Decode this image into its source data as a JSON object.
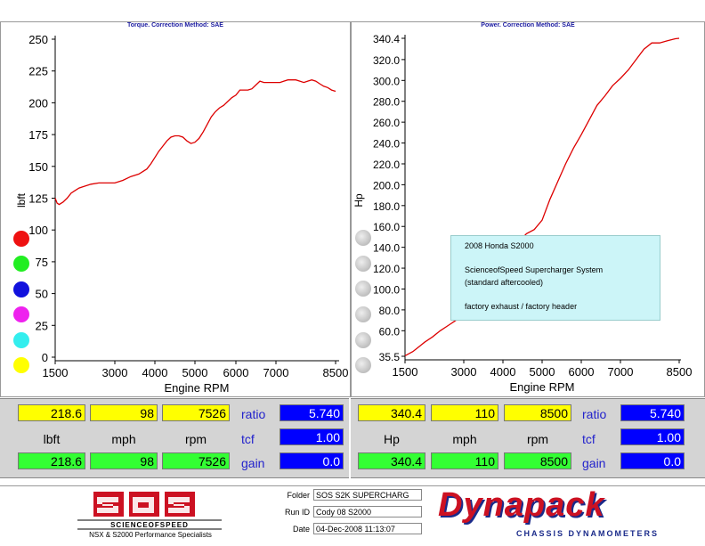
{
  "left_chart": {
    "header": "Torque.      Correction Method: SAE",
    "ylabel": "lbft",
    "xlabel": "Engine RPM",
    "yticks": [
      "250",
      "225",
      "200",
      "175",
      "150",
      "125",
      "100",
      "75",
      "50",
      "25",
      "0"
    ],
    "xticks": [
      "1500",
      "3000",
      "4000",
      "5000",
      "6000",
      "7000",
      "8500"
    ]
  },
  "right_chart": {
    "header": "Power.      Correction Method: SAE",
    "ylabel": "Hp",
    "xlabel": "Engine RPM",
    "yticks": [
      "340.4",
      "320.0",
      "300.0",
      "280.0",
      "260.0",
      "240.0",
      "220.0",
      "200.0",
      "180.0",
      "160.0",
      "140.0",
      "120.0",
      "100.0",
      "80.0",
      "60.0",
      "35.5"
    ],
    "xticks": [
      "1500",
      "3000",
      "4000",
      "5000",
      "6000",
      "7000",
      "8500"
    ]
  },
  "note": {
    "line1": "2008 Honda S2000",
    "line2": "ScienceofSpeed Supercharger System",
    "line3": "(standard aftercooled)",
    "line4": "factory exhaust / factory header"
  },
  "left_readout": {
    "top": [
      "218.6",
      "98",
      "7526"
    ],
    "units": [
      "lbft",
      "mph",
      "rpm"
    ],
    "bottom": [
      "218.6",
      "98",
      "7526"
    ],
    "ratio_label": "ratio",
    "ratio": "5.740",
    "tcf_label": "tcf",
    "tcf": "1.00",
    "gain_label": "gain",
    "gain": "0.0"
  },
  "right_readout": {
    "top": [
      "340.4",
      "110",
      "8500"
    ],
    "units": [
      "Hp",
      "mph",
      "rpm"
    ],
    "bottom": [
      "340.4",
      "110",
      "8500"
    ],
    "ratio_label": "ratio",
    "ratio": "5.740",
    "tcf_label": "tcf",
    "tcf": "1.00",
    "gain_label": "gain",
    "gain": "0.0"
  },
  "footer": {
    "logo_text": "SCIENCEOFSPEED",
    "tagline": "NSX & S2000 Performance Specialists",
    "folder_label": "Folder",
    "folder": "SOS S2K SUPERCHARG",
    "runid_label": "Run ID",
    "runid": "Cody 08 S2000",
    "date_label": "Date",
    "date": "04-Dec-2008  11:13:07",
    "brand": "Dynapack",
    "brand_sub": "CHASSIS DYNAMOMETERS"
  },
  "colors": {
    "curve": "#dd0000",
    "yellow": "#ffff00",
    "green": "#33ff33",
    "blue": "#0000ff",
    "brand_red": "#cc1122",
    "brand_blue": "#1a2a8a"
  },
  "swatches_left": [
    "#ee1111",
    "#22ee22",
    "#1111dd",
    "#ee22ee",
    "#33eeee",
    "#ffff00"
  ],
  "chart_data": [
    {
      "type": "line",
      "title": "Torque.      Correction Method: SAE",
      "xlabel": "Engine RPM",
      "ylabel": "lbft",
      "xlim": [
        1500,
        8500
      ],
      "ylim": [
        0,
        250
      ],
      "series": [
        {
          "x": [
            1500,
            1550,
            1600,
            1700,
            1800,
            1900,
            2000,
            2100,
            2200,
            2400,
            2600,
            2800,
            3000,
            3200,
            3400,
            3600,
            3800,
            3900,
            4000,
            4100,
            4200,
            4300,
            4400,
            4500,
            4600,
            4700,
            4800,
            4900,
            5000,
            5100,
            5200,
            5300,
            5400,
            5500,
            5600,
            5700,
            5800,
            5900,
            6000,
            6100,
            6200,
            6300,
            6400,
            6500,
            6600,
            6700,
            6800,
            6900,
            7000,
            7100,
            7200,
            7300,
            7400,
            7500,
            7600,
            7700,
            7800,
            7900,
            8000,
            8100,
            8200,
            8300,
            8400,
            8500
          ],
          "y": [
            125,
            121,
            120,
            122,
            125,
            129,
            131,
            133,
            134,
            136,
            137,
            137,
            137,
            139,
            142,
            144,
            148,
            152,
            157,
            162,
            166,
            170,
            173,
            174,
            174,
            173,
            170,
            168,
            169,
            172,
            177,
            183,
            189,
            193,
            196,
            198,
            201,
            204,
            206,
            210,
            210,
            210,
            211,
            214,
            217,
            216,
            216,
            216,
            216,
            216,
            217,
            218,
            218,
            218,
            217,
            216,
            217,
            218,
            217,
            215,
            213,
            212,
            210,
            209
          ]
        }
      ]
    },
    {
      "type": "line",
      "title": "Power.      Correction Method: SAE",
      "xlabel": "Engine RPM",
      "ylabel": "Hp",
      "xlim": [
        1500,
        8500
      ],
      "ylim": [
        35.5,
        340.4
      ],
      "series": [
        {
          "x": [
            1500,
            1600,
            1700,
            1800,
            1900,
            2000,
            2200,
            2400,
            2600,
            2800,
            3000,
            3200,
            3400,
            3600,
            3800,
            4000,
            4200,
            4400,
            4600,
            4800,
            5000,
            5200,
            5400,
            5600,
            5800,
            6000,
            6200,
            6400,
            6600,
            6800,
            7000,
            7200,
            7400,
            7600,
            7800,
            8000,
            8200,
            8400,
            8500
          ],
          "y": [
            36,
            38,
            40,
            43,
            46,
            49,
            54,
            60,
            65,
            70,
            75,
            80,
            86,
            92,
            100,
            112,
            130,
            145,
            153,
            157,
            166,
            186,
            203,
            220,
            235,
            248,
            262,
            276,
            285,
            295,
            302,
            310,
            320,
            330,
            336,
            336,
            338,
            340,
            340.4
          ]
        }
      ]
    }
  ]
}
